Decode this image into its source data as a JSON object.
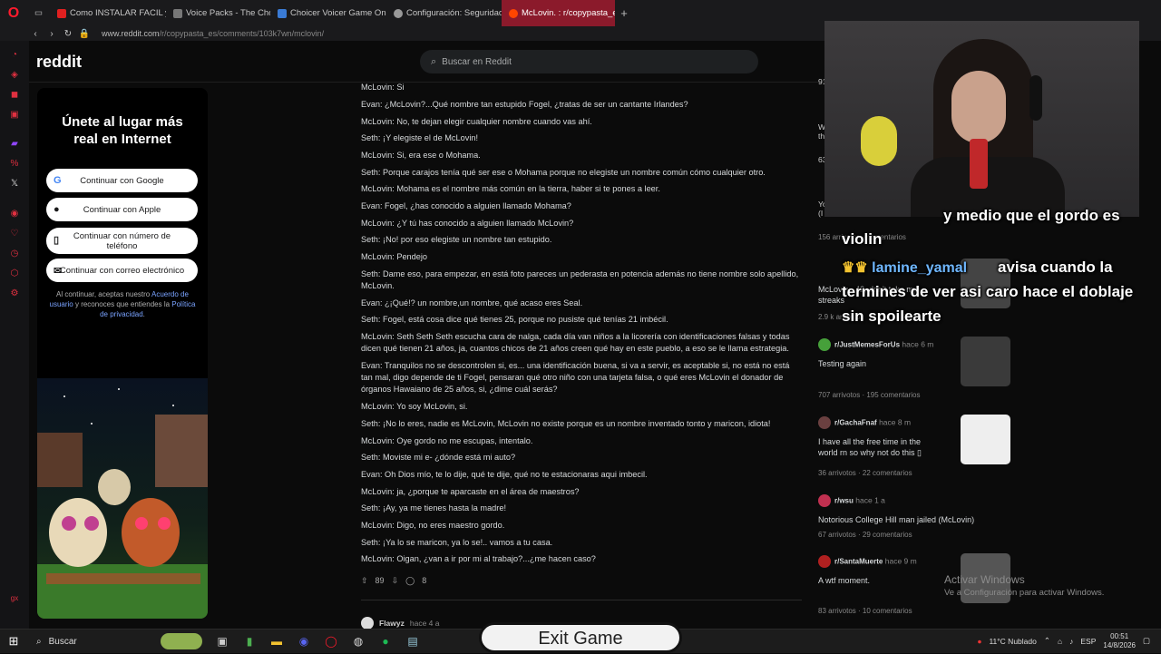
{
  "browser": {
    "tabs": [
      {
        "label": "Como INSTALAR FACIL y R",
        "color": "#e02020"
      },
      {
        "label": "Voice Packs - The Choicer",
        "color": "#777777"
      },
      {
        "label": "Choicer Voicer Game Onli",
        "color": "#3a7bd5"
      },
      {
        "label": "Configuración: Seguridad",
        "color": "#999999"
      },
      {
        "label": "McLovin. : r/copypasta_es",
        "color": "#ff4500"
      }
    ],
    "newtab": "+",
    "url_host": "www.reddit.com",
    "url_path": "/r/copypasta_es/comments/103k7wn/mclovin/"
  },
  "reddit": {
    "logo": "reddit",
    "search_placeholder": "Buscar en Reddit"
  },
  "signup": {
    "title": "Únete al lugar más real en Internet",
    "google": "Continuar con Google",
    "apple": "Continuar con Apple",
    "phone": "Continuar con número de teléfono",
    "email": "Continuar con correo electrónico",
    "legal_pre": "Al continuar, aceptas nuestro ",
    "legal_terms": "Acuerdo de usuario",
    "legal_mid": " y reconoces que entiendes la ",
    "legal_privacy": "Política de privacidad",
    "legal_end": "."
  },
  "post_lines": [
    "McLovin: Si",
    "Evan: ¿McLovin?...Qué nombre tan estupido Fogel, ¿tratas de ser un cantante Irlandes?",
    "McLovin: No, te dejan elegir cualquier nombre cuando vas ahí.",
    "Seth: ¡Y elegiste el de McLovin!",
    "McLovin: Si, era ese o Mohama.",
    "Seth: Porque carajos tenía qué ser ese o Mohama porque no elegiste un nombre común cómo cualquier otro.",
    "McLovin: Mohama es el nombre más común en la tierra, haber si te pones a leer.",
    "Evan: Fogel, ¿has conocido a alguien llamado Mohama?",
    "McLovin: ¿Y tú has conocido a alguien llamado McLovin?",
    "Seth: ¡No! por eso elegiste un nombre tan estupido.",
    "McLovin: Pendejo",
    "Seth: Dame eso, para empezar, en está foto pareces un pederasta en potencia además no tiene nombre solo apellido, McLovin.",
    "Evan: ¿¡Qué!? un nombre,un nombre, qué acaso eres Seal.",
    "Seth: Fogel, está cosa dice qué tienes 25, porque no pusiste qué tenías 21 imbécil.",
    "McLovin: Seth Seth Seth escucha cara de nalga, cada día van niños a la licorería con identificaciones falsas y todas dicen qué tienen 21 años, ja, cuantos chicos de 21 años creen qué hay en este pueblo, a eso se le llama estrategia.",
    "Evan: Tranquilos no se descontrolen si, es... una identificación buena, si va a servir, es aceptable si, no está no está tan mal, digo depende de ti Fogel, pensaran qué otro niño con una tarjeta falsa, o qué eres McLovin el donador de órganos Hawaiano de 25 años, si, ¿dime cuál serás?",
    "McLovin: Yo soy McLovin, si.",
    "Seth: ¡No lo eres, nadie es McLovin, McLovin no existe porque es un nombre inventado tonto y maricon, idiota!",
    "McLovin: Oye gordo no me escupas, intentalo.",
    "Seth: Moviste mi e- ¿dónde está mi auto?",
    "Evan: Oh Dios mío, te lo dije, qué te dije, qué no te estacionaras aqui imbecil.",
    "McLovin: ja, ¿porque te aparcaste en el área de maestros?",
    "Seth: ¡Ay, ya me tienes hasta la madre!",
    "McLovin: Digo, no eres maestro gordo.",
    "Seth: ¡Ya lo se maricon, ya lo se!.. vamos a tu casa.",
    "McLovin: Oigan, ¿van a ir por mi al trabajo?...¿me hacen caso?"
  ],
  "post_actions": {
    "votes": "89",
    "comments": "8"
  },
  "next_post": {
    "user": "Flawyz",
    "time": "hace 4 a"
  },
  "sidebar": [
    {
      "sub": "",
      "time": "",
      "title": "",
      "arrivals": "156 arrivotos",
      "comments": "comentarios"
    },
    {
      "sub": "",
      "time": "",
      "title": "McLovin...42, don't take my streaks",
      "arrivals": "2.9 k arrivotos",
      "comments": ""
    },
    {
      "sub": "r/JustMemesForUs",
      "time": "hace 6 m",
      "title": "Testing again",
      "arrivals": "707 arrivotos",
      "comments": "195 comentarios"
    },
    {
      "sub": "r/GachaFnaf",
      "time": "hace 8 m",
      "title": "I have all the free time in the world rn so why not do this ▯",
      "arrivals": "36 arrivotos",
      "comments": "22 comentarios"
    },
    {
      "sub": "r/wsu",
      "time": "hace 1 a",
      "title": "Notorious College Hill man jailed (McLovin)",
      "arrivals": "67 arrivotos",
      "comments": "29 comentarios"
    },
    {
      "sub": "r/SantaMuerte",
      "time": "hace 9 m",
      "title": "A wtf moment.",
      "arrivals": "83 arrivotos",
      "comments": "10 comentarios"
    }
  ],
  "sidebar_partial": {
    "n1": "91",
    "n2": "63",
    "w": "W",
    "th": "th",
    "yo": "Yo",
    "ilove": "(I love",
    "e": "E"
  },
  "overlay": {
    "line1": "y medio que el gordo es",
    "line2": "violin",
    "name": "lamine_yamal",
    "line3": "avisa cuando la",
    "line4": "termines de ver asi caro hace el doblaje",
    "line5": "sin spoilearte"
  },
  "windows": {
    "activate": "Activar Windows",
    "activate_sub": "Ve a Configuración para activar Windows.",
    "search": "Buscar",
    "weather": "11°C  Nublado",
    "lang": "ESP",
    "time": "00:51",
    "date": "14/8/2026",
    "exit_game": "Exit Game"
  }
}
